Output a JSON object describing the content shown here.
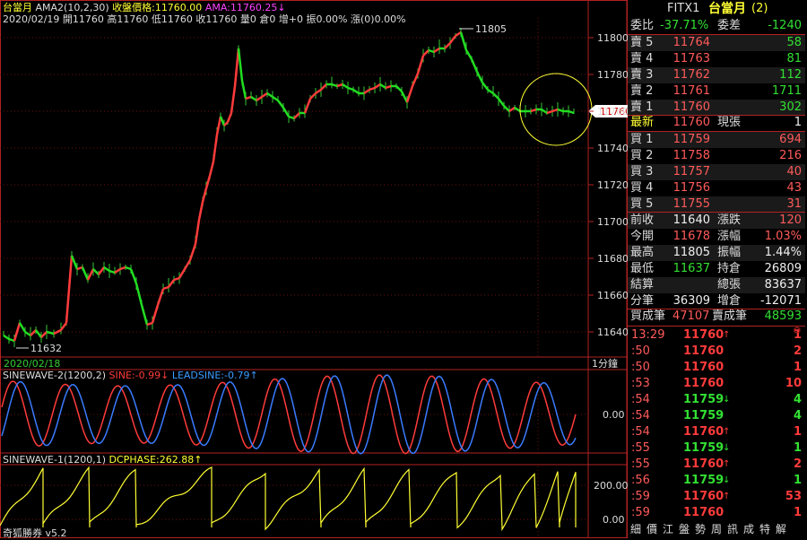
{
  "header": {
    "symbol": "台當月",
    "indicator": "AMA2(10,2,30)",
    "close_label": "收盤價格:11760.00",
    "ama_label": "AMA:11760.25",
    "ama_arrow": "↓",
    "ohlc": "2020/02/19 開11760 高11760 低11760 收11760 量0 倉0 增+0 振0.00% 漲(0)0.00%"
  },
  "main_chart": {
    "y_ticks": [
      "11800",
      "11780",
      "11760",
      "11740",
      "11720",
      "11700",
      "11680",
      "11660",
      "11640"
    ],
    "high_label": "11805",
    "low_label": "11632",
    "current_price": "11760",
    "date_label": "2020/02/18",
    "interval": "1分鐘"
  },
  "sine2": {
    "title": "SINEWAVE-2(1200,2)",
    "sine_label": "SINE:-0.99",
    "sine_arrow": "↓",
    "lead_label": "LEADSINE:-0.79",
    "lead_arrow": "↑",
    "y_tick": "0.00"
  },
  "sine1": {
    "title": "SINEWAVE-1(1200,1)",
    "phase_label": "DCPHASE:262.88",
    "phase_arrow": "↑",
    "y_ticks": [
      "200.00",
      "0.00"
    ]
  },
  "footer": {
    "brand": "奇狐勝券 v5.2"
  },
  "panel": {
    "code": "FITX1",
    "name": "台當月",
    "name_suffix": "(2)",
    "ratio_label": "委比",
    "ratio_value": "-37.71%",
    "diff_label": "委差",
    "diff_value": "-1240",
    "asks": [
      {
        "label": "賣 5",
        "price": "11764",
        "vol": "58"
      },
      {
        "label": "賣 4",
        "price": "11763",
        "vol": "81"
      },
      {
        "label": "賣 3",
        "price": "11762",
        "vol": "112"
      },
      {
        "label": "賣 2",
        "price": "11761",
        "vol": "1711"
      },
      {
        "label": "賣 1",
        "price": "11760",
        "vol": "302"
      }
    ],
    "last_label": "最新",
    "last_price": "11760",
    "cur_label": "現張",
    "cur_vol": "1",
    "bids": [
      {
        "label": "買 1",
        "price": "11759",
        "vol": "694"
      },
      {
        "label": "買 2",
        "price": "11758",
        "vol": "216"
      },
      {
        "label": "買 3",
        "price": "11757",
        "vol": "40"
      },
      {
        "label": "買 4",
        "price": "11756",
        "vol": "43"
      },
      {
        "label": "買 5",
        "price": "11755",
        "vol": "31"
      }
    ],
    "stats": [
      {
        "l1": "前收",
        "v1": "11640",
        "l2": "漲跌",
        "v2": "120"
      },
      {
        "l1": "今開",
        "v1": "11678",
        "l2": "漲幅",
        "v2": "1.03%"
      },
      {
        "l1": "最高",
        "v1": "11805",
        "l2": "振幅",
        "v2": "1.44%"
      },
      {
        "l1": "最低",
        "v1": "11637",
        "l2": "持倉",
        "v2": "26809"
      },
      {
        "l1": "結算",
        "v1": "",
        "l2": "總張",
        "v2": "83637"
      },
      {
        "l1": "分筆",
        "v1": "36309",
        "l2": "增倉",
        "v2": "-12071"
      }
    ],
    "buy_trades_label": "買成筆",
    "buy_trades": "47107",
    "sell_trades_label": "賣成筆",
    "sell_trades": "48593",
    "ticks": [
      {
        "time": "13:29",
        "price": "11760",
        "arrow": "↑",
        "vol": "1",
        "color": "red"
      },
      {
        "time": ":50",
        "price": "11760",
        "arrow": "",
        "vol": "2",
        "color": "red"
      },
      {
        "time": ":50",
        "price": "11760",
        "arrow": "",
        "vol": "1",
        "color": "red"
      },
      {
        "time": ":53",
        "price": "11760",
        "arrow": "",
        "vol": "10",
        "color": "red"
      },
      {
        "time": ":54",
        "price": "11759",
        "arrow": "↓",
        "vol": "4",
        "color": "green"
      },
      {
        "time": ":54",
        "price": "11759",
        "arrow": "",
        "vol": "4",
        "color": "green"
      },
      {
        "time": ":54",
        "price": "11760",
        "arrow": "↑",
        "vol": "1",
        "color": "red"
      },
      {
        "time": ":55",
        "price": "11759",
        "arrow": "↓",
        "vol": "1",
        "color": "green"
      },
      {
        "time": ":55",
        "price": "11760",
        "arrow": "↑",
        "vol": "2",
        "color": "red"
      },
      {
        "time": ":56",
        "price": "11759",
        "arrow": "↓",
        "vol": "1",
        "color": "green"
      },
      {
        "time": ":59",
        "price": "11760",
        "arrow": "↑",
        "vol": "53",
        "color": "red"
      },
      {
        "time": ":59",
        "price": "11760",
        "arrow": "",
        "vol": "1",
        "color": "red"
      }
    ],
    "tabs": [
      "細",
      "價",
      "江",
      "盤",
      "勢",
      "周",
      "訊",
      "成",
      "特",
      "解"
    ]
  },
  "colors": {
    "red": "#ff3b3b",
    "green": "#22dd22",
    "blue": "#3a7bff",
    "yellow": "#ffff33",
    "grid": "#8b1a1a",
    "frame": "#b22222"
  }
}
